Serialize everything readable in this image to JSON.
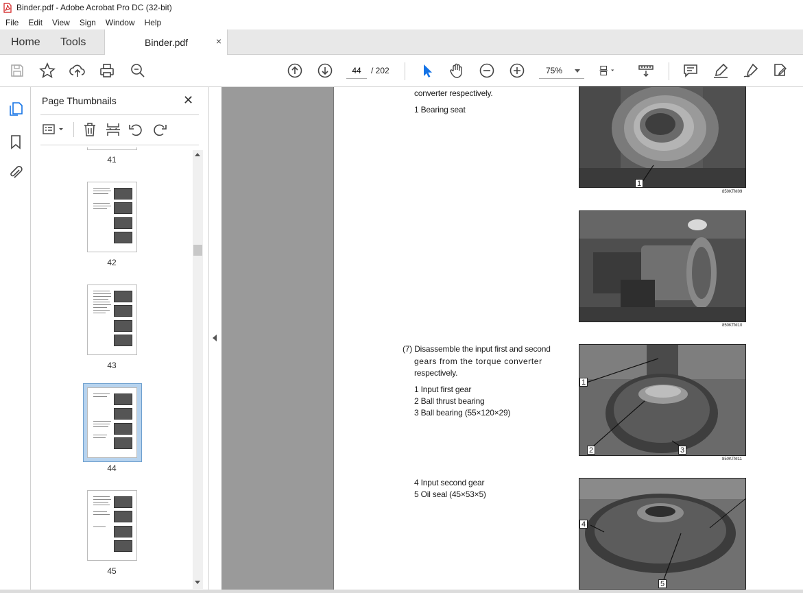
{
  "window": {
    "title": "Binder.pdf - Adobe Acrobat Pro DC (32-bit)"
  },
  "menu": [
    "File",
    "Edit",
    "View",
    "Sign",
    "Window",
    "Help"
  ],
  "tabs": {
    "home": "Home",
    "tools": "Tools",
    "document": "Binder.pdf",
    "close": "×"
  },
  "toolbar": {
    "current_page": "44",
    "page_total": "/  202",
    "zoom": "75%"
  },
  "panel": {
    "title": "Page Thumbnails",
    "close": "✕",
    "pages": [
      {
        "label": "41"
      },
      {
        "label": "42"
      },
      {
        "label": "43"
      },
      {
        "label": "44",
        "selected": true
      },
      {
        "label": "45"
      }
    ]
  },
  "document": {
    "texts": {
      "t0": "converter respectively.",
      "t1": "1    Bearing seat",
      "t2a": "(7)  Disassemble the input first and second",
      "t2b": "gears  from  the  torque  converter",
      "t2c": "respectively.",
      "t3": "1    Input first gear",
      "t4": "2    Ball thrust bearing",
      "t5": "3    Ball bearing (55×120×29)",
      "t6": "4    Input second gear",
      "t7": "5    Oil seal (45×53×5)"
    },
    "captions": {
      "c1": "850KTM09",
      "c2": "850KTM10",
      "c3": "850KTM11"
    },
    "callouts": {
      "p1": "1",
      "p3a": "1",
      "p3b": "2",
      "p3c": "3",
      "p4a": "4",
      "p4b": "5"
    }
  },
  "colors": {
    "accent": "#1473e6",
    "selected_thumb": "#b7d3ee",
    "doc_background": "#9a9a9a"
  }
}
